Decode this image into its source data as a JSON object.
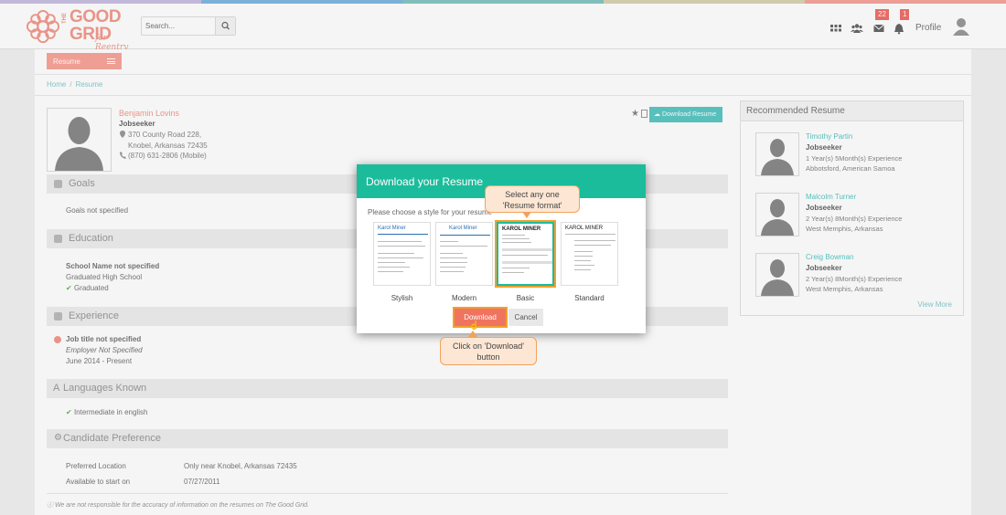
{
  "colors": {
    "bar": [
      "#c9c0e2",
      "#7fb9e0",
      "#85c6c2",
      "#d8d4b2",
      "#f4a59b"
    ],
    "accent": "#f39b8e",
    "teal": "#1bbc9b"
  },
  "logo": {
    "top": "THE",
    "word1": "GOOD",
    "word2": "GRID",
    "tagline": "for Reentry"
  },
  "search": {
    "placeholder": "Search...",
    "icon": "search-icon"
  },
  "header": {
    "badge_messages": "22",
    "badge_notifications": "1",
    "profile_label": "Profile"
  },
  "nav": {
    "resume_tab": "Resume"
  },
  "breadcrumb": {
    "home": "Home",
    "current": "Resume"
  },
  "profile": {
    "name": "Benjamin Lovins",
    "role": "Jobseeker",
    "address1": "370 County Road 228,",
    "address2": "Knobel, Arkansas 72435",
    "phone": "(870) 631-2806 (Mobile)",
    "download_button": "Download Resume"
  },
  "sections": {
    "goals": {
      "title": "Goals",
      "text": "Goals not specified"
    },
    "education": {
      "title": "Education",
      "school": "School Name not specified",
      "degree": "Graduated High School",
      "status": "Graduated"
    },
    "experience": {
      "title": "Experience",
      "job": "Job title not specified",
      "employer": "Employer Not Specified",
      "dates": "June 2014 - Present"
    },
    "languages": {
      "title": "Languages Known",
      "item": "Intermediate in english"
    },
    "preference": {
      "title": "Candidate Preference",
      "rows": [
        {
          "label": "Preferred Location",
          "value": "Only near Knobel, Arkansas 72435"
        },
        {
          "label": "Available to start on",
          "value": "07/27/2011"
        }
      ]
    }
  },
  "recommended": {
    "title": "Recommended Resume",
    "items": [
      {
        "name": "Timothy Partin",
        "role": "Jobseeker",
        "experience": "1 Year(s) 5Month(s) Experience",
        "location": "Abbotsford, American Samoa"
      },
      {
        "name": "Malcolm Turner",
        "role": "Jobseeker",
        "experience": "2 Year(s) 8Month(s) Experience",
        "location": "West Memphis, Arkansas"
      },
      {
        "name": "Creig Bowman",
        "role": "Jobseeker",
        "experience": "2 Year(s) 8Month(s) Experience",
        "location": "West Memphis, Arkansas"
      }
    ],
    "view_more": "View More"
  },
  "disclaimer": "We are not responsible for the accuracy of information on the resumes on The Good Grid.",
  "modal": {
    "title": "Download your Resume",
    "prompt": "Please choose a style for your resume",
    "thumb_name": "Karol Miner",
    "thumb_name_caps": "KAROL MINER",
    "styles": [
      "Stylish",
      "Modern",
      "Basic",
      "Standard"
    ],
    "selected": "Basic",
    "download": "Download",
    "cancel": "Cancel"
  },
  "callouts": {
    "select": [
      "Select any one",
      "'Resume format'"
    ],
    "download": [
      "Click on 'Download'",
      "button"
    ]
  }
}
